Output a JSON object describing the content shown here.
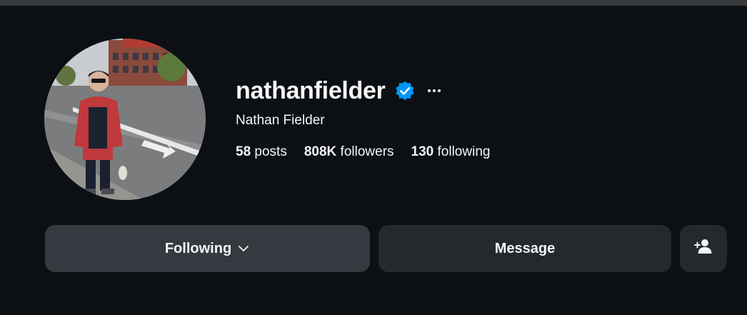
{
  "profile": {
    "username": "nathanfielder",
    "full_name": "Nathan Fielder",
    "verified": true,
    "stats": {
      "posts_count": "58",
      "posts_label": "posts",
      "followers_count": "808K",
      "followers_label": "followers",
      "following_count": "130",
      "following_label": "following"
    }
  },
  "actions": {
    "following_label": "Following",
    "message_label": "Message"
  },
  "icons": {
    "verified": "verified-badge-icon",
    "more": "more-options-icon",
    "chevron": "chevron-down-icon",
    "add_person": "add-person-icon"
  },
  "colors": {
    "background": "#0c1014",
    "verified_blue": "#0095f6",
    "following_button": "#363a40",
    "secondary_button": "#25292e"
  }
}
